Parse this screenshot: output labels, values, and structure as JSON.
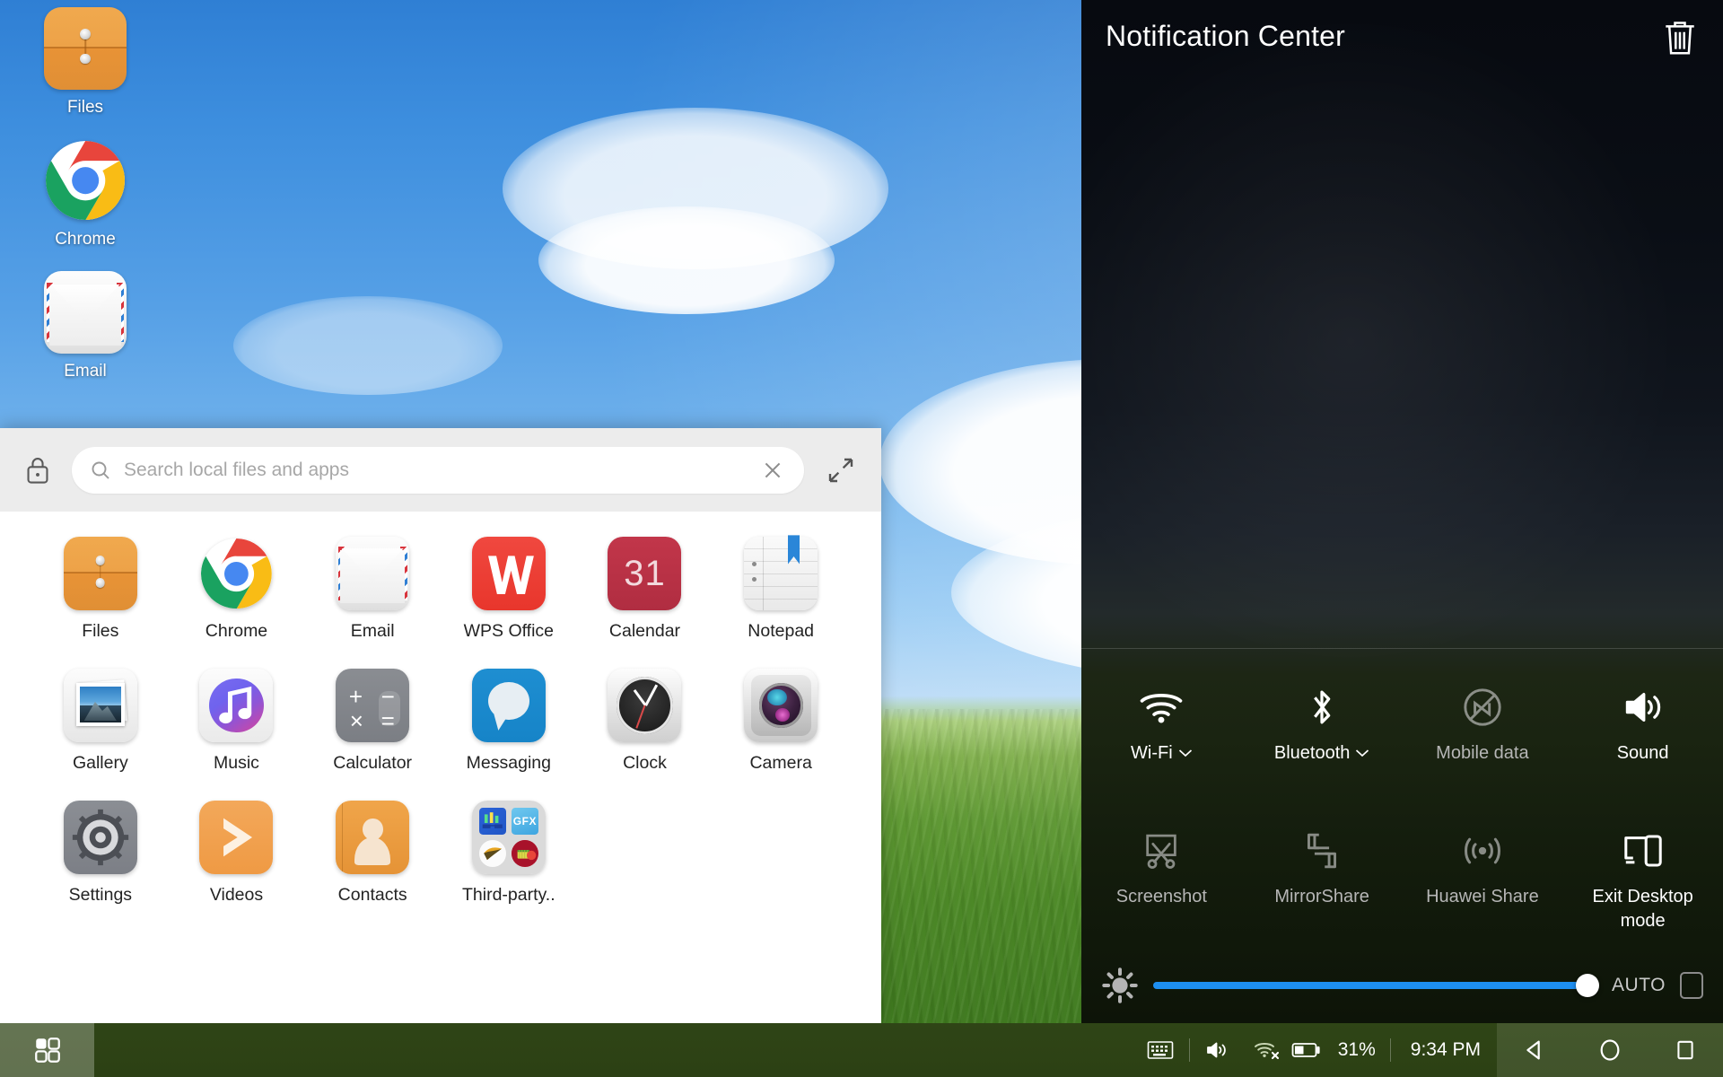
{
  "desktop": {
    "icons": [
      {
        "label": "Files",
        "icon": "files-icon"
      },
      {
        "label": "Chrome",
        "icon": "chrome-icon"
      },
      {
        "label": "Email",
        "icon": "email-icon"
      }
    ]
  },
  "drawer": {
    "lock_icon": "lock-icon",
    "search": {
      "placeholder": "Search local files and apps",
      "value": "",
      "search_icon": "search-icon",
      "clear_icon": "close-icon"
    },
    "expand_icon": "expand-icon",
    "apps": [
      {
        "label": "Files",
        "icon": "files-icon"
      },
      {
        "label": "Chrome",
        "icon": "chrome-icon"
      },
      {
        "label": "Email",
        "icon": "email-icon"
      },
      {
        "label": "WPS Office",
        "icon": "wps-office-icon"
      },
      {
        "label": "Calendar",
        "icon": "calendar-icon",
        "badge": "31"
      },
      {
        "label": "Notepad",
        "icon": "notepad-icon"
      },
      {
        "label": "Gallery",
        "icon": "gallery-icon"
      },
      {
        "label": "Music",
        "icon": "music-icon"
      },
      {
        "label": "Calculator",
        "icon": "calculator-icon"
      },
      {
        "label": "Messaging",
        "icon": "messaging-icon"
      },
      {
        "label": "Clock",
        "icon": "clock-icon"
      },
      {
        "label": "Camera",
        "icon": "camera-icon"
      },
      {
        "label": "Settings",
        "icon": "settings-icon"
      },
      {
        "label": "Videos",
        "icon": "videos-icon"
      },
      {
        "label": "Contacts",
        "icon": "contacts-icon"
      },
      {
        "label": "Third-party..",
        "icon": "folder-icon",
        "folder_badge": "GFX"
      }
    ]
  },
  "notification_center": {
    "title": "Notification Center",
    "clear_all_icon": "trash-icon",
    "quick_settings": [
      {
        "label": "Wi-Fi",
        "icon": "wifi-icon",
        "state": "on",
        "has_chevron": true
      },
      {
        "label": "Bluetooth",
        "icon": "bluetooth-icon",
        "state": "on",
        "has_chevron": true
      },
      {
        "label": "Mobile data",
        "icon": "mobile-data-off-icon",
        "state": "off",
        "has_chevron": false
      },
      {
        "label": "Sound",
        "icon": "sound-icon",
        "state": "on",
        "has_chevron": false
      },
      {
        "label": "Screenshot",
        "icon": "screenshot-icon",
        "state": "off",
        "has_chevron": false
      },
      {
        "label": "MirrorShare",
        "icon": "mirrorshare-icon",
        "state": "off",
        "has_chevron": false
      },
      {
        "label": "Huawei Share",
        "icon": "huawei-share-icon",
        "state": "off",
        "has_chevron": false
      },
      {
        "label": "Exit Desktop mode",
        "icon": "desktop-mode-icon",
        "state": "on",
        "has_chevron": false
      }
    ],
    "brightness": {
      "icon": "brightness-icon",
      "value_percent": 100,
      "auto_label": "AUTO",
      "auto_checked": false
    }
  },
  "taskbar": {
    "launcher_icon": "app-launcher-icon",
    "tray": [
      {
        "name": "keyboard-icon",
        "type": "icon"
      },
      {
        "name": "volume-icon",
        "type": "icon"
      },
      {
        "name": "wifi-off-icon",
        "type": "icon"
      },
      {
        "name": "battery-icon",
        "type": "icon"
      }
    ],
    "battery_percent": "31%",
    "clock": "9:34 PM",
    "nav": [
      {
        "name": "back-button",
        "icon": "triangle-left-icon"
      },
      {
        "name": "home-button",
        "icon": "circle-icon"
      },
      {
        "name": "recents-button",
        "icon": "square-icon"
      }
    ]
  },
  "colors": {
    "accent_blue": "#1d8ef0",
    "taskbar_green": "#2c4014",
    "panel_dark": "#0a0d13",
    "drawer_bg": "#ffffff",
    "drawer_header": "#ececec"
  }
}
